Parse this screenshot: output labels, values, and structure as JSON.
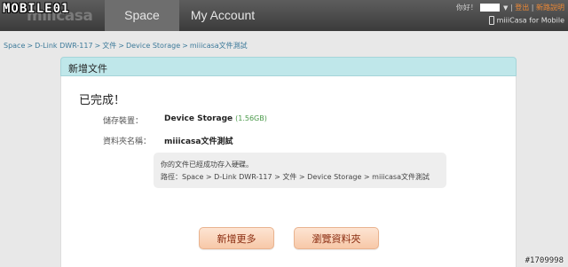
{
  "header": {
    "watermark_logo": "MOBILE01",
    "app_logo": "miiicasa",
    "tabs": [
      {
        "label": "Space",
        "active": true
      },
      {
        "label": "My Account",
        "active": false
      }
    ],
    "greeting": "你好！",
    "logout": "登出",
    "new_features": "新路說明",
    "mobile_link": "miiiCasa for Mobile"
  },
  "breadcrumb": [
    "Space",
    "D-Link DWR-117",
    "文件",
    "Device Storage",
    "miiicasa文件測試"
  ],
  "breadcrumb_separator": ">",
  "panel": {
    "title": "新增文件",
    "status": "已完成！",
    "fields": [
      {
        "label": "儲存裝置：",
        "value": "Device Storage",
        "note": "(1.56GB)"
      },
      {
        "label": "資料夾名稱：",
        "value": "miiicasa文件測試",
        "note": ""
      }
    ],
    "message": "你的文件已經成功存入硬碟。",
    "path_label": "路徑：",
    "path": "Space > D-Link DWR-117 > 文件 > Device Storage > miiicasa文件測試"
  },
  "buttons": {
    "add_more": "新增更多",
    "browse_folder": "瀏覽資料夾"
  },
  "watermark_id": "#1709998",
  "colors": {
    "topbar": "#4a4a4a",
    "panel_header": "#bfe7ea",
    "link": "#3d7a9a",
    "button_text": "#8a2c10",
    "button_bg": "#f9d3b8"
  }
}
